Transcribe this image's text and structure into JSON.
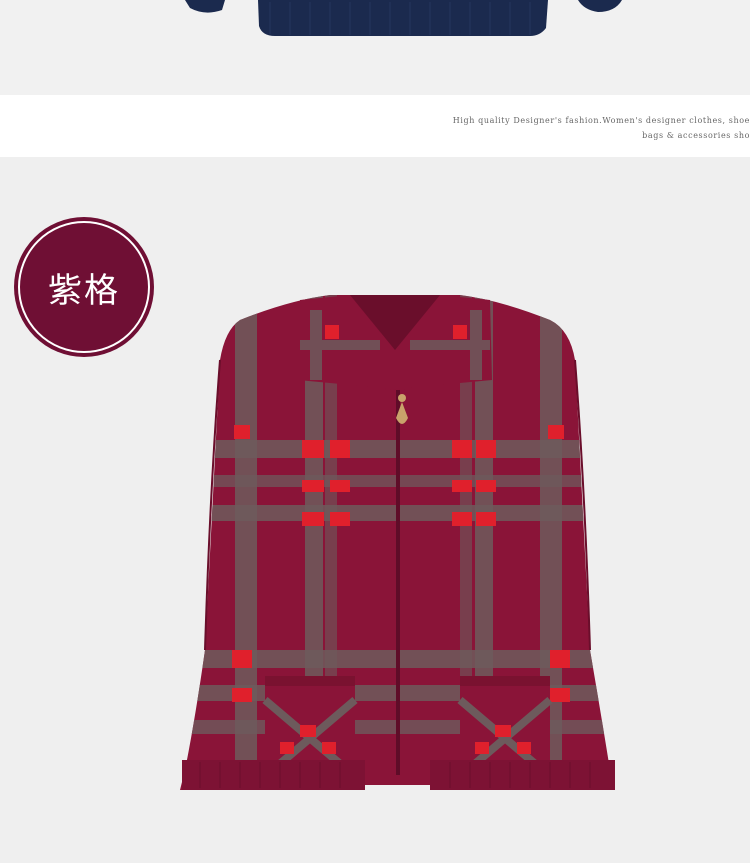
{
  "banner": {
    "line1": "High quality Designer's fashion.Women's designer clothes, shoe",
    "line2": "bags & accessories sho"
  },
  "badge": {
    "label": "紫格"
  },
  "colors": {
    "badge_fill": "#6f0f34",
    "garment_base": "#8a1438",
    "plaid_grey": "#6d5a5c",
    "plaid_red": "#e0202c",
    "top_garment": "#1b2a4e"
  }
}
